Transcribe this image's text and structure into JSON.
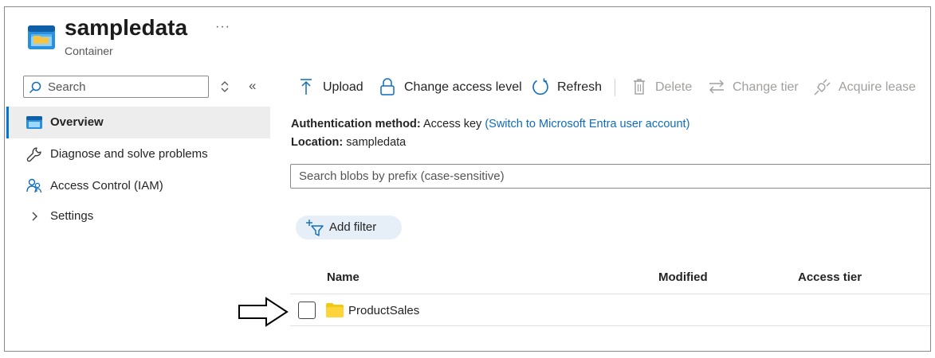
{
  "header": {
    "title": "sampledata",
    "more_label": "···",
    "subtitle": "Container",
    "icon": "storage-container-icon"
  },
  "sidebar": {
    "search_placeholder": "Search",
    "collapse_label": "«",
    "items": [
      {
        "label": "Overview",
        "icon": "container-icon",
        "active": true
      },
      {
        "label": "Diagnose and solve problems",
        "icon": "wrench-icon",
        "active": false
      },
      {
        "label": "Access Control (IAM)",
        "icon": "people-icon",
        "active": false
      },
      {
        "label": "Settings",
        "icon": "chevron-right-icon",
        "active": false
      }
    ]
  },
  "toolbar": {
    "upload": "Upload",
    "change_access": "Change access level",
    "refresh": "Refresh",
    "delete": "Delete",
    "change_tier": "Change tier",
    "acquire_lease": "Acquire lease"
  },
  "info": {
    "auth_label": "Authentication method:",
    "auth_value": "Access key",
    "auth_link": "(Switch to Microsoft Entra user account)",
    "location_label": "Location:",
    "location_value": "sampledata"
  },
  "blob_search": {
    "placeholder": "Search blobs by prefix (case-sensitive)"
  },
  "filter": {
    "label": "Add filter"
  },
  "table": {
    "columns": [
      "Name",
      "Modified",
      "Access tier"
    ],
    "rows": [
      {
        "name": "ProductSales",
        "type": "folder",
        "checked": false
      }
    ]
  },
  "colors": {
    "accent": "#0078d4",
    "link": "#0f6cbd",
    "folder": "#f2c811",
    "active_bg": "#ededed"
  }
}
